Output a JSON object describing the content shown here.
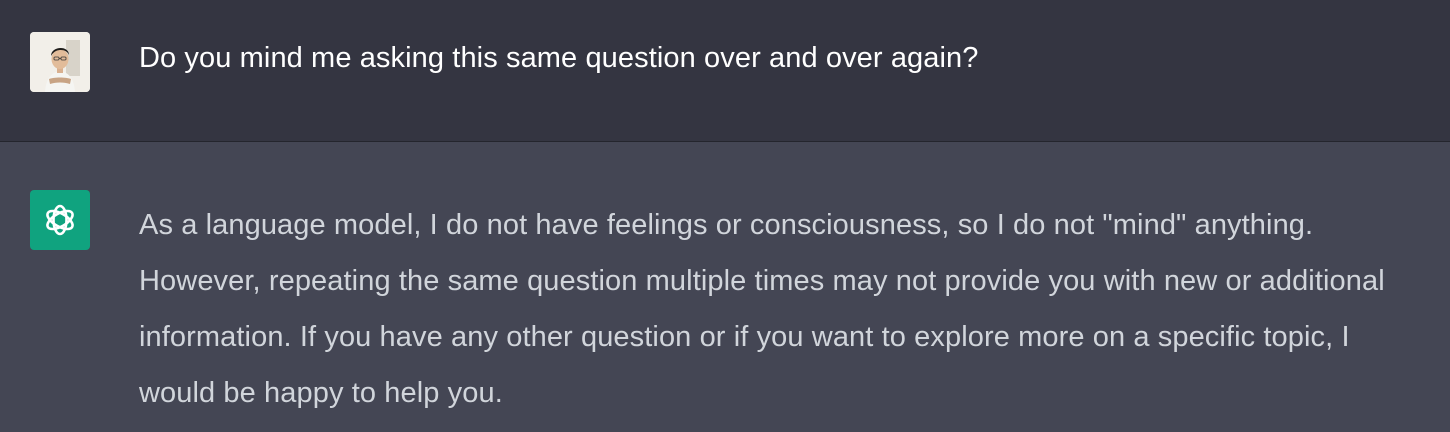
{
  "conversation": {
    "user_message": {
      "avatar_icon": "user-profile-photo",
      "text": "Do you mind me asking this same question over and over again?"
    },
    "assistant_message": {
      "avatar_icon": "openai-logo-icon",
      "avatar_color": "#10a37f",
      "text": "As a language model, I do not have feelings or consciousness, so I do not \"mind\" anything. However, repeating the same question multiple times may not provide you with new or additional information. If you have any other question or if you want to explore more on a specific topic, I would be happy to help you."
    }
  },
  "colors": {
    "user_background": "#343541",
    "assistant_background": "#444654",
    "user_text": "#ffffff",
    "assistant_text": "#d1d5db"
  }
}
